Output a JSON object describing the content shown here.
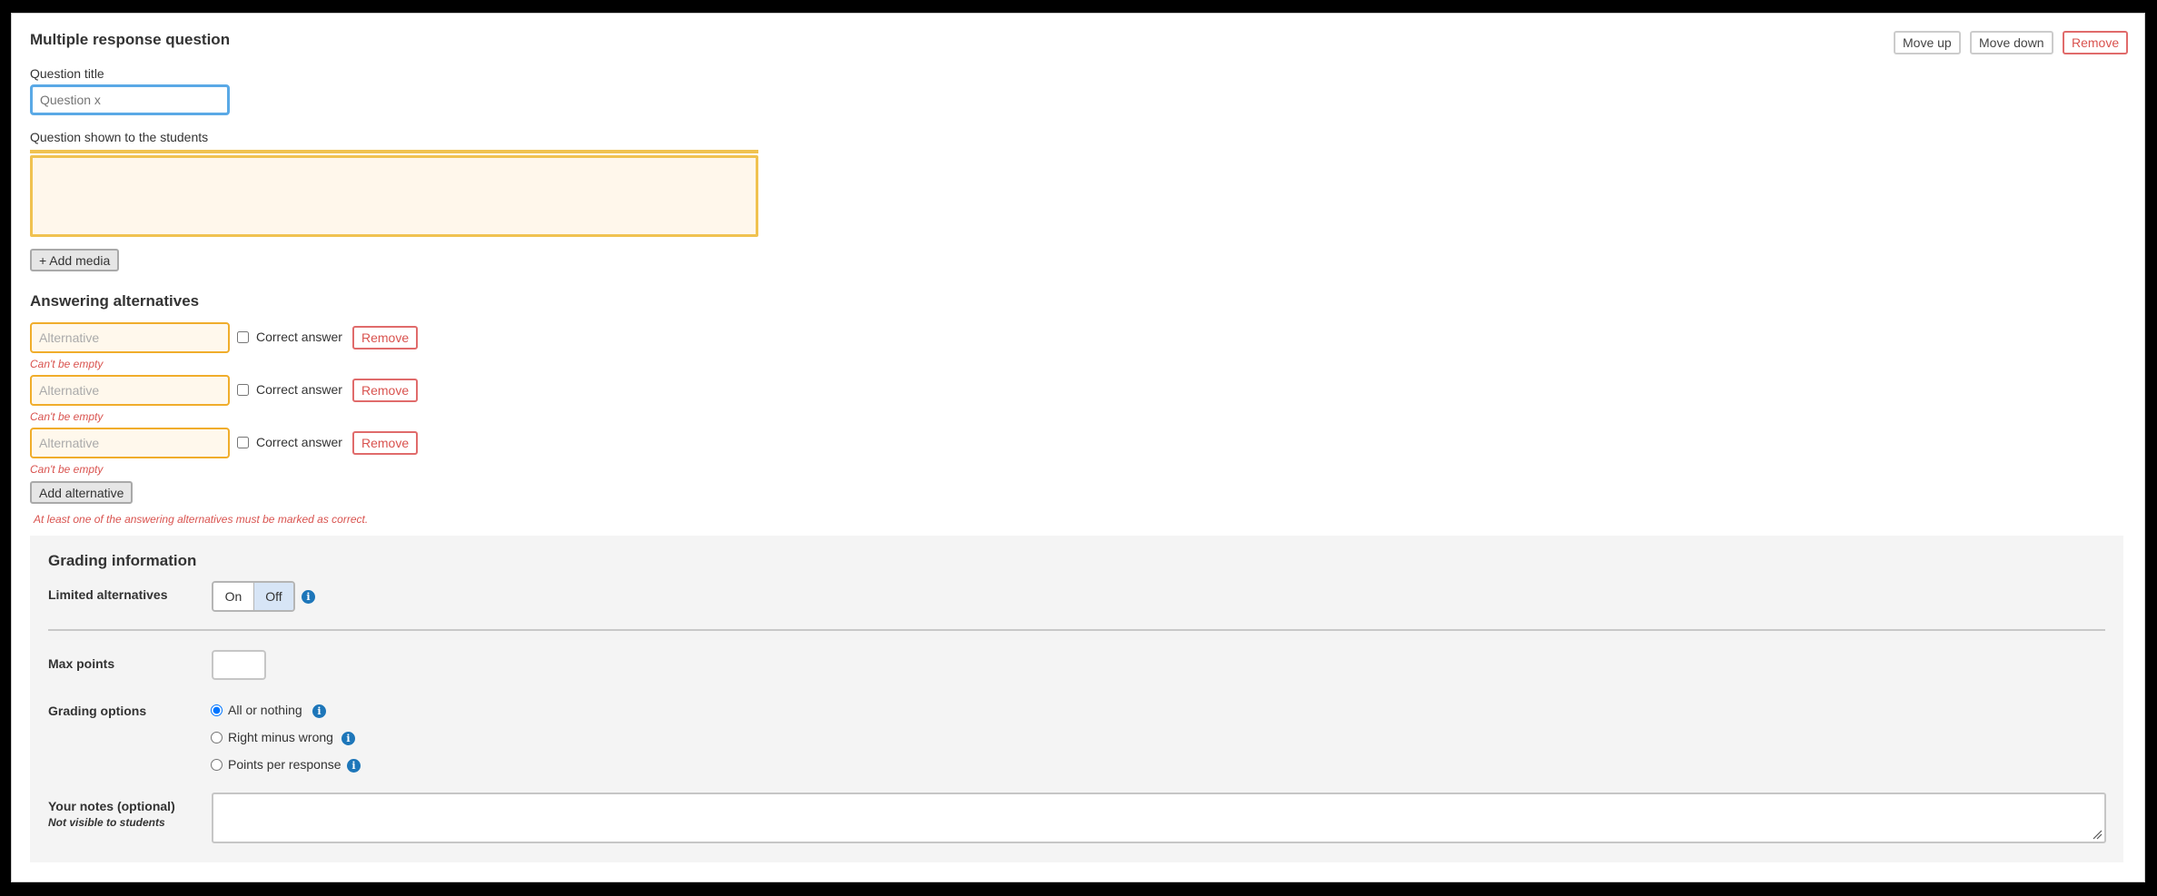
{
  "question": {
    "heading": "Multiple response question",
    "move_up": "Move up",
    "move_down": "Move down",
    "remove": "Remove",
    "title_label": "Question title",
    "title_placeholder": "Question x",
    "shown_label": "Question shown to the students",
    "add_media": "+ Add media"
  },
  "alternatives": {
    "heading": "Answering alternatives",
    "items": [
      {
        "placeholder": "Alternative",
        "correct_label": "Correct answer",
        "remove": "Remove",
        "error": "Can't be empty"
      },
      {
        "placeholder": "Alternative",
        "correct_label": "Correct answer",
        "remove": "Remove",
        "error": "Can't be empty"
      },
      {
        "placeholder": "Alternative",
        "correct_label": "Correct answer",
        "remove": "Remove",
        "error": "Can't be empty"
      }
    ],
    "add_button": "Add alternative",
    "error_message": "At least one of the answering alternatives must be marked as correct."
  },
  "grading": {
    "heading": "Grading information",
    "limited_label": "Limited alternatives",
    "toggle_on": "On",
    "toggle_off": "Off",
    "toggle_selected": "Off",
    "max_points_label": "Max points",
    "options_label": "Grading options",
    "options": [
      {
        "label": "All or nothing",
        "selected": true
      },
      {
        "label": "Right minus wrong",
        "selected": false
      },
      {
        "label": "Points per response",
        "selected": false
      }
    ],
    "notes_label": "Your notes (optional)",
    "notes_sub": "Not visible to students"
  },
  "icons": {
    "info": "info-icon",
    "resize": "resize-handle-icon"
  },
  "colors": {
    "danger": "#d9534f",
    "warning_border": "#f0ad2b",
    "focus_border": "#5aa9e6",
    "info_blue": "#1d76b9",
    "toggle_selected": "#d7e5f6"
  }
}
